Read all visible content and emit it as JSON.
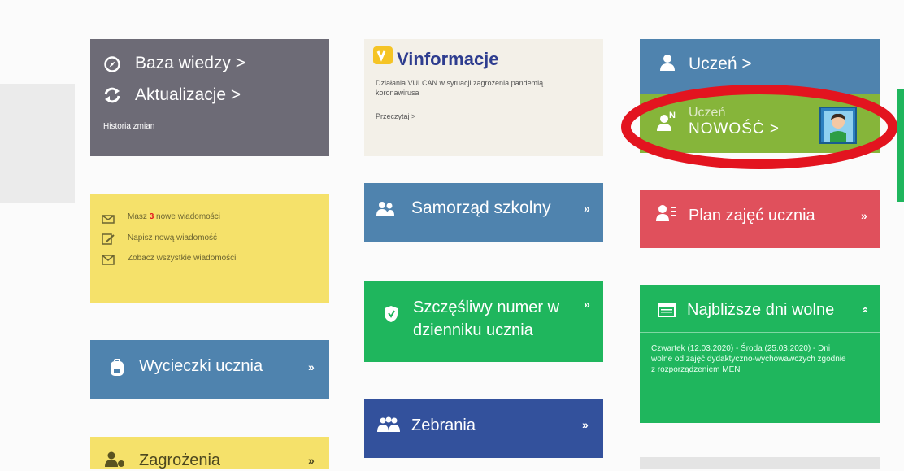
{
  "knowledge": {
    "baza": "Baza wiedzy >",
    "aktualizacje": "Aktualizacje >",
    "historia": "Historia zmian"
  },
  "vinfo": {
    "title": "Vinformacje",
    "text": "Działania VULCAN w sytuacji zagrożenia pandemią koronawirusa",
    "link": "Przeczytaj >"
  },
  "uczen": {
    "label": "Uczeń >"
  },
  "uczen_new": {
    "line1": "Uczeń",
    "line2": "NOWOŚĆ >",
    "badge": "N"
  },
  "messages": {
    "prefix": "Masz",
    "count": "3",
    "suffix": "nowe wiadomości",
    "write": "Napisz nową wiadomość",
    "all": "Zobacz wszystkie wiadomości"
  },
  "samorzad": {
    "label": "Samorząd szkolny"
  },
  "plan": {
    "label": "Plan zajęć ucznia"
  },
  "szczesliwy": {
    "line1": "Szczęśliwy numer w",
    "line2": "dzienniku ucznia"
  },
  "dni_wolne": {
    "label": "Najbliższe dni wolne",
    "text": "Czwartek (12.03.2020) - Środa (25.03.2020) - Dni wolne od zajęć dydaktyczno-wychowawczych zgodnie z rozporządzeniem MEN"
  },
  "wycieczki": {
    "label": "Wycieczki ucznia"
  },
  "zebrania": {
    "label": "Zebrania"
  },
  "zagrozenia": {
    "label": "Zagrożenia"
  },
  "colors": {
    "gray": "#6d6b76",
    "blue": "#4f83ae",
    "green": "#1fb65d",
    "lime": "#86b53a",
    "red": "#e0505c",
    "yellow": "#f5e16a",
    "navy": "#33519c",
    "highlight": "#e3141f"
  }
}
